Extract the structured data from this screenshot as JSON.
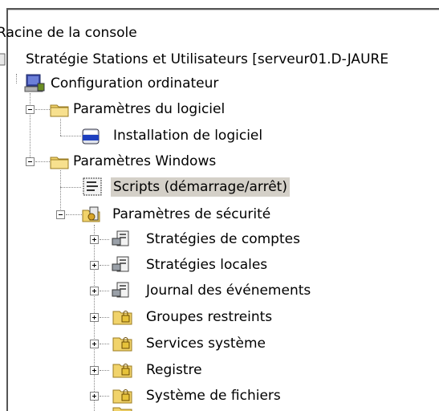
{
  "tree": {
    "root": "Racine de la console",
    "policy": "Stratégie Stations et Utilisateurs [serveur01.D-JAURE",
    "computer_config": "Configuration ordinateur",
    "software_settings": "Paramètres du logiciel",
    "software_install": "Installation de logiciel",
    "windows_settings": "Paramètres Windows",
    "scripts": "Scripts (démarrage/arrêt)",
    "security_settings": "Paramètres de sécurité",
    "account_policies": "Stratégies de comptes",
    "local_policies": "Stratégies locales",
    "event_log": "Journal des événements",
    "restricted_groups": "Groupes restreints",
    "system_services": "Services système",
    "registry": "Registre",
    "file_system": "Système de fichiers"
  },
  "colors": {
    "selection": "#d4d0c8",
    "folder": "#f1d36b"
  },
  "icons": {
    "computer_config": "computer-icon",
    "folder": "folder-icon",
    "software_install": "package-icon",
    "scripts": "script-icon",
    "security_settings": "security-folder-icon",
    "policy": "policy-icon",
    "locked_folder": "locked-folder-icon"
  }
}
